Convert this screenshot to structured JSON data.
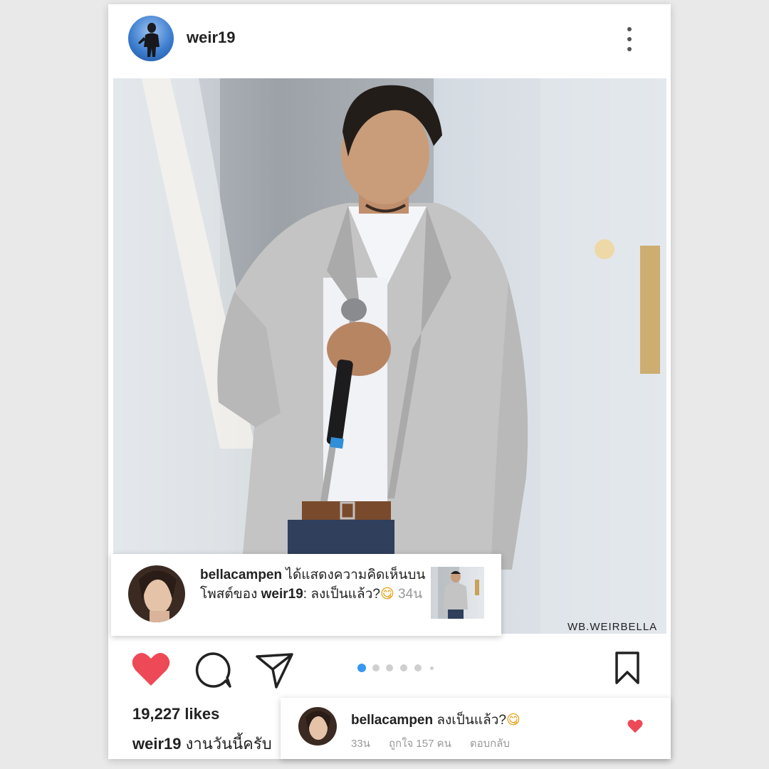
{
  "post": {
    "username": "weir19",
    "watermark": "WB.WEIRBELLA",
    "likes": "19,227 likes",
    "caption_user": "weir19",
    "caption_text": " งานวันนี้ครับ",
    "carousel_dots": 6,
    "carousel_active_index": 0
  },
  "notification": {
    "user": "bellacampen",
    "text_part1": " ได้แสดงความคิดเห็นบนโพสต์ของ ",
    "post_user": "weir19",
    "text_part2": ": ลงเป็นแล้ว?",
    "emoji": "😋",
    "time": "34น"
  },
  "comment": {
    "user": "bellacampen",
    "text": " ลงเป็นแล้ว?",
    "emoji": "😋",
    "time": "33น",
    "likes": "ถูกใจ 157 คน",
    "reply": "ตอบกลับ"
  },
  "colors": {
    "heart": "#ed4956",
    "active_dot": "#3897f0",
    "inactive_dot": "#cfcfcf"
  },
  "icons": [
    "more-vertical-icon",
    "heart-icon",
    "comment-icon",
    "share-icon",
    "bookmark-icon"
  ]
}
